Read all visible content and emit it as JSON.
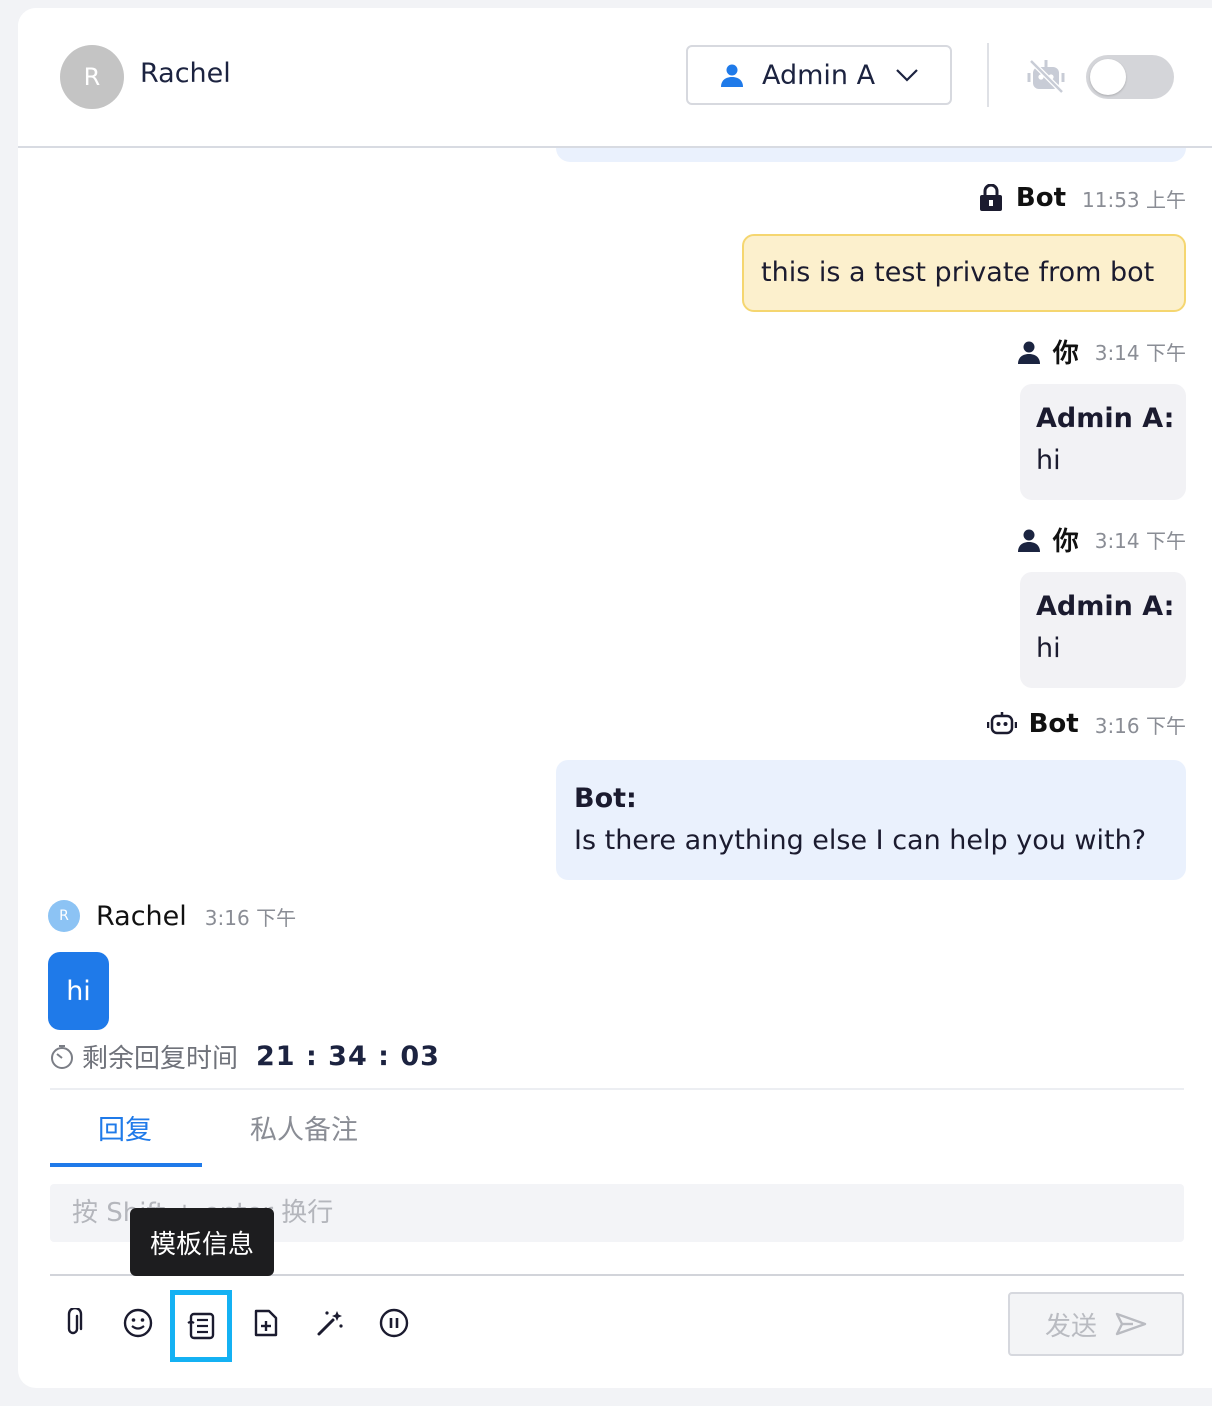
{
  "header": {
    "avatar_initial": "R",
    "contact_name": "Rachel",
    "assignee": "Admin A",
    "bot_toggle_on": false
  },
  "messages": {
    "private": {
      "author": "Bot",
      "time": "11:53 上午",
      "text": "this is a test private from bot"
    },
    "admin1": {
      "author": "你",
      "time": "3:14 下午",
      "sender": "Admin A:",
      "text": "hi"
    },
    "admin2": {
      "author": "你",
      "time": "3:14 下午",
      "sender": "Admin A:",
      "text": "hi"
    },
    "bot": {
      "author": "Bot",
      "time": "3:16 下午",
      "sender": "Bot:",
      "text": "Is there anything else I can help you with?"
    },
    "user": {
      "avatar_initial": "R",
      "author": "Rachel",
      "time": "3:16 下午",
      "text": "hi"
    }
  },
  "remaining": {
    "label": "剩余回复时间",
    "countdown": "21 : 34 : 03"
  },
  "composer": {
    "tabs": [
      "回复",
      "私人备注"
    ],
    "active_tab": "回复",
    "placeholder": "按 Shift + enter 换行",
    "tooltip": "模板信息",
    "send_label": "发送",
    "tools": [
      "paperclip-icon",
      "emoji-icon",
      "template-icon",
      "add-file-icon",
      "magic-wand-icon",
      "pause-icon"
    ]
  },
  "colors": {
    "accent": "#1f7ae9",
    "private_bg": "#fcf0cd",
    "bot_bg": "#eaf1fd",
    "highlight": "#14b1f3"
  }
}
